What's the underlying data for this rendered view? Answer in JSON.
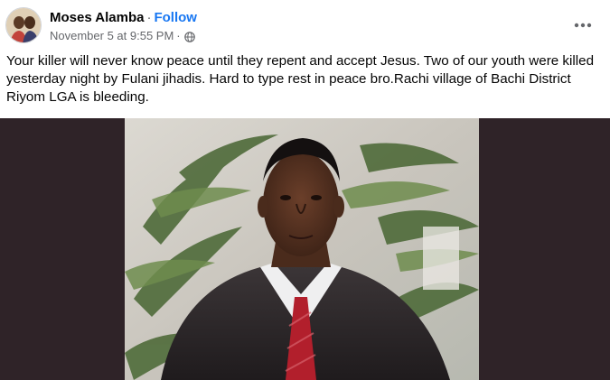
{
  "post": {
    "author": {
      "name": "Moses Alamba",
      "separator": "·",
      "follow_label": "Follow"
    },
    "meta": {
      "timestamp": "November 5 at 9:55 PM",
      "separator": "·",
      "privacy_icon": "globe-icon"
    },
    "more_icon": "more-options-icon",
    "text": "Your killer will never know peace until they repent and accept Jesus. Two of our youth were killed yesterday night by Fulani jihadis. Hard to type rest in peace bro.Rachi village of Bachi District Riyom LGA is bleeding.",
    "colors": {
      "link": "#1877f2",
      "secondary_text": "#65676b",
      "primary_text": "#050505",
      "media_background": "#2f2328"
    }
  }
}
